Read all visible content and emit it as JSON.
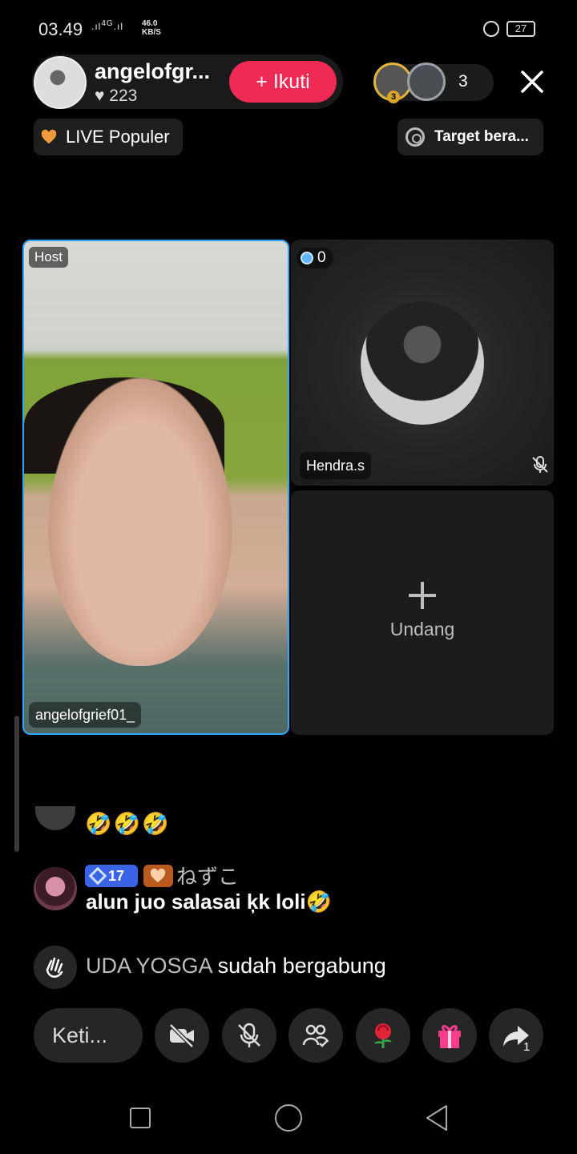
{
  "status_bar": {
    "time": "03.49",
    "signal": "4G",
    "speed_value": "46.0",
    "speed_unit": "KB/S",
    "battery": "27"
  },
  "header": {
    "host_name": "angelofgr...",
    "likes": "♥ 223",
    "follow_label": "+ Ikuti",
    "viewer_badge": "3",
    "viewer_count": "3",
    "close_icon": "close-icon"
  },
  "chips": {
    "live_popular": "LIVE Populer",
    "target": "Target bera..."
  },
  "tiles": {
    "host_tag": "Host",
    "host_name": "angelofgrief01_",
    "guest_coins": "0",
    "guest_name": "Hendra.s",
    "invite_label": "Undang"
  },
  "chat": {
    "previous_emojis": "🤣🤣🤣",
    "message": {
      "level": "17",
      "username": "ねずこ",
      "text": "alun juo salasai ķk loli🤣"
    },
    "join": {
      "name": "UDA YOSGA",
      "text": " sudah bergabung"
    }
  },
  "bottom_bar": {
    "input_placeholder": "Keti...",
    "share_count": "1",
    "buttons": [
      "video-off-icon",
      "mic-off-icon",
      "guests-icon",
      "rose-icon",
      "gift-icon",
      "share-icon"
    ]
  },
  "colors": {
    "accent": "#ef2a55",
    "host_border": "#2fa7ff",
    "level_badge": "#3a64e6"
  }
}
